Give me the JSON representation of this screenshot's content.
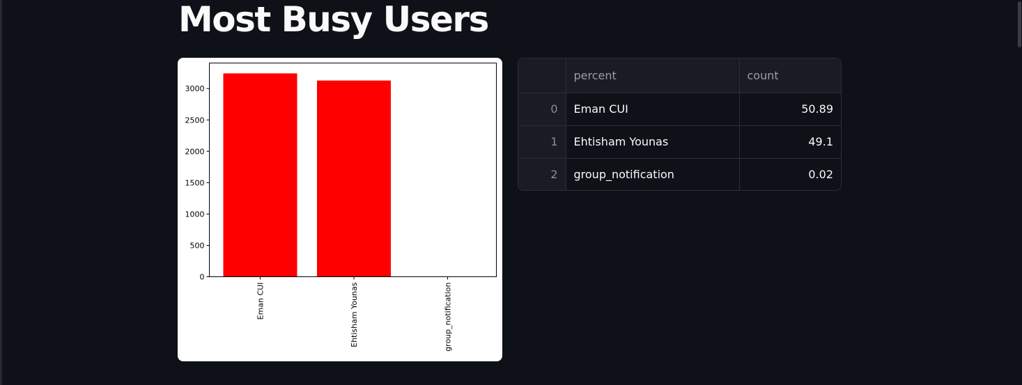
{
  "page": {
    "title": "Most Busy Users"
  },
  "chart_data": {
    "type": "bar",
    "categories": [
      "Eman CUI",
      "Ehtisham Younas",
      "group_notification"
    ],
    "values": [
      3242,
      3128,
      1
    ],
    "yticks": [
      0,
      500,
      1000,
      1500,
      2000,
      2500,
      3000
    ],
    "ylim": [
      0,
      3400
    ],
    "bar_color": "#ff0000",
    "title": "",
    "xlabel": "",
    "ylabel": ""
  },
  "table": {
    "columns": [
      "",
      "percent",
      "count"
    ],
    "rows": [
      {
        "index": "0",
        "percent": "Eman CUI",
        "count": "50.89"
      },
      {
        "index": "1",
        "percent": "Ehtisham Younas",
        "count": "49.1"
      },
      {
        "index": "2",
        "percent": "group_notification",
        "count": "0.02"
      }
    ]
  },
  "colors": {
    "background": "#0e1117",
    "text": "#fafafa",
    "header_bg": "#1a1c23",
    "grid": "#2b2e36"
  }
}
